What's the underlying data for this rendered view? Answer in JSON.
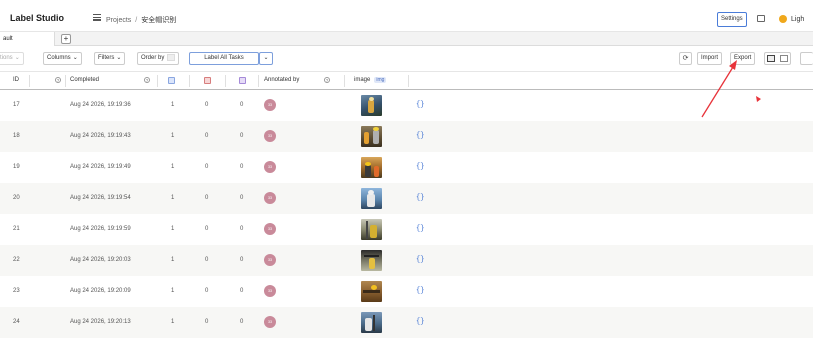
{
  "header": {
    "logo": "Label Studio",
    "breadcrumb": {
      "projects": "Projects",
      "separator": "/",
      "current": "安全帽识别"
    },
    "settings_label": "Settings",
    "theme_label": "Ligh"
  },
  "tabs": {
    "active_label": "ault",
    "add_label": "+"
  },
  "toolbar": {
    "actions_label": "tions",
    "columns_label": "Columns",
    "filters_label": "Filters",
    "order_label": "Order by",
    "label_all_label": "Label All Tasks",
    "import_label": "Import",
    "export_label": "Export"
  },
  "table": {
    "columns": {
      "id": "ID",
      "completed": "Completed",
      "annotated_by": "Annotated by",
      "image": "image",
      "image_badge": "img"
    },
    "rows": [
      {
        "id": "17",
        "completed": "Aug 24 2026, 19:19:36",
        "total": "1",
        "cancelled": "0",
        "predictions": "0",
        "avatar": "33",
        "data": "{}"
      },
      {
        "id": "18",
        "completed": "Aug 24 2026, 19:19:43",
        "total": "1",
        "cancelled": "0",
        "predictions": "0",
        "avatar": "33",
        "data": "{}"
      },
      {
        "id": "19",
        "completed": "Aug 24 2026, 19:19:49",
        "total": "1",
        "cancelled": "0",
        "predictions": "0",
        "avatar": "33",
        "data": "{}"
      },
      {
        "id": "20",
        "completed": "Aug 24 2026, 19:19:54",
        "total": "1",
        "cancelled": "0",
        "predictions": "0",
        "avatar": "33",
        "data": "{}"
      },
      {
        "id": "21",
        "completed": "Aug 24 2026, 19:19:59",
        "total": "1",
        "cancelled": "0",
        "predictions": "0",
        "avatar": "33",
        "data": "{}"
      },
      {
        "id": "22",
        "completed": "Aug 24 2026, 19:20:03",
        "total": "1",
        "cancelled": "0",
        "predictions": "0",
        "avatar": "33",
        "data": "{}"
      },
      {
        "id": "23",
        "completed": "Aug 24 2026, 19:20:09",
        "total": "1",
        "cancelled": "0",
        "predictions": "0",
        "avatar": "33",
        "data": "{}"
      },
      {
        "id": "24",
        "completed": "Aug 24 2026, 19:20:13",
        "total": "1",
        "cancelled": "0",
        "predictions": "0",
        "avatar": "33",
        "data": "{}"
      }
    ]
  },
  "colors": {
    "accent_blue": "#4a7cd8",
    "theme_dot": "#f0a81b",
    "avatar": "#c98a9a",
    "annotation_arrow": "#e8333a",
    "total_icon": "#dbe5fb",
    "cancelled_icon": "#f7d6d6",
    "predictions_icon": "#e6dcf7"
  },
  "icons": [
    "menu-icon",
    "chat-icon",
    "sun-icon",
    "refresh-icon",
    "list-view-icon",
    "grid-view-icon",
    "help-icon",
    "total-annotations-icon",
    "cancelled-annotations-icon",
    "predictions-icon"
  ]
}
